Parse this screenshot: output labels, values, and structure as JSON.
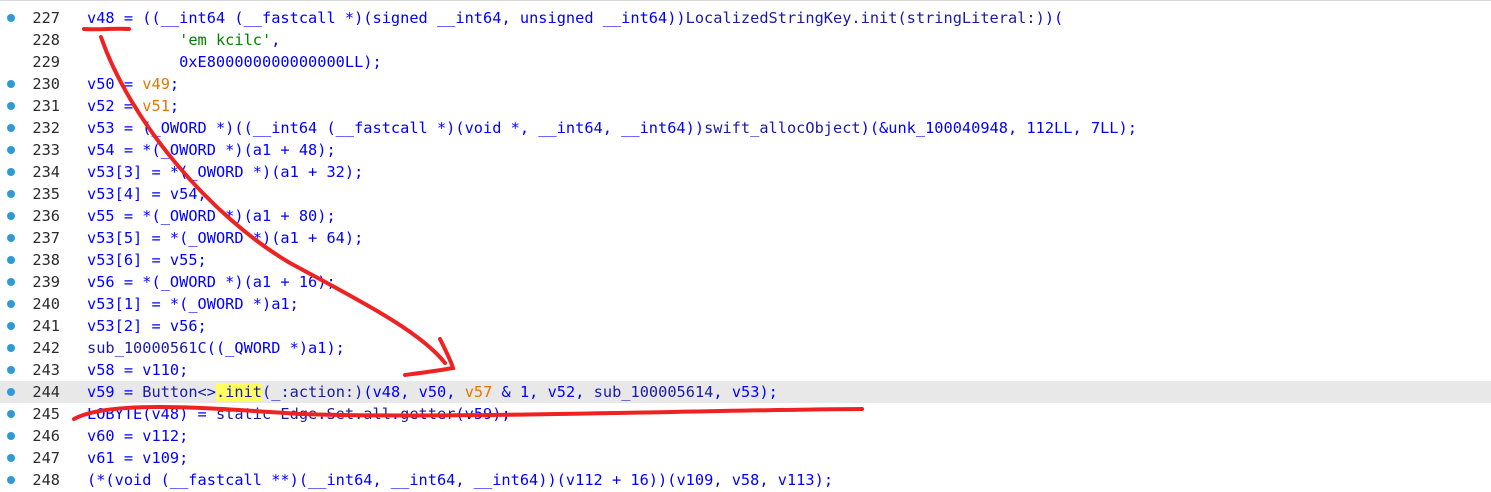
{
  "editor": {
    "current_line": 244,
    "lines": [
      {
        "num": "227",
        "dot": true,
        "tokens": [
          [
            "v",
            "v48"
          ],
          [
            "n",
            " = ((__int64 (__fastcall *)(signed __int64, unsigned __int64))"
          ],
          [
            "f",
            "LocalizedStringKey.init(stringLiteral:)"
          ],
          [
            "n",
            ")("
          ]
        ]
      },
      {
        "num": "228",
        "dot": false,
        "tokens": [
          [
            "n",
            "          "
          ],
          [
            "s",
            "'em kcilc'"
          ],
          [
            "n",
            ","
          ]
        ]
      },
      {
        "num": "229",
        "dot": false,
        "tokens": [
          [
            "n",
            "          0xE800000000000000LL);"
          ]
        ]
      },
      {
        "num": "230",
        "dot": true,
        "tokens": [
          [
            "v",
            "v50"
          ],
          [
            "n",
            " = "
          ],
          [
            "o",
            "v49"
          ],
          [
            "n",
            ";"
          ]
        ]
      },
      {
        "num": "231",
        "dot": true,
        "tokens": [
          [
            "v",
            "v52"
          ],
          [
            "n",
            " = "
          ],
          [
            "o",
            "v51"
          ],
          [
            "n",
            ";"
          ]
        ]
      },
      {
        "num": "232",
        "dot": true,
        "tokens": [
          [
            "v",
            "v53"
          ],
          [
            "n",
            " = (_OWORD *)((__int64 (__fastcall *)(void *, __int64, __int64))"
          ],
          [
            "f",
            "swift_allocObject"
          ],
          [
            "n",
            ")(&unk_100040948, 112LL, 7LL);"
          ]
        ]
      },
      {
        "num": "233",
        "dot": true,
        "tokens": [
          [
            "v",
            "v54"
          ],
          [
            "n",
            " = *(_OWORD *)("
          ],
          [
            "v",
            "a1"
          ],
          [
            "n",
            " + 48);"
          ]
        ]
      },
      {
        "num": "234",
        "dot": true,
        "tokens": [
          [
            "v",
            "v53"
          ],
          [
            "n",
            "[3] = *(_OWORD *)("
          ],
          [
            "v",
            "a1"
          ],
          [
            "n",
            " + 32);"
          ]
        ]
      },
      {
        "num": "235",
        "dot": true,
        "tokens": [
          [
            "v",
            "v53"
          ],
          [
            "n",
            "[4] = "
          ],
          [
            "v",
            "v54"
          ],
          [
            "n",
            ";"
          ]
        ]
      },
      {
        "num": "236",
        "dot": true,
        "tokens": [
          [
            "v",
            "v55"
          ],
          [
            "n",
            " = *(_OWORD *)("
          ],
          [
            "v",
            "a1"
          ],
          [
            "n",
            " + 80);"
          ]
        ]
      },
      {
        "num": "237",
        "dot": true,
        "tokens": [
          [
            "v",
            "v53"
          ],
          [
            "n",
            "[5] = *(_OWORD *)("
          ],
          [
            "v",
            "a1"
          ],
          [
            "n",
            " + 64);"
          ]
        ]
      },
      {
        "num": "238",
        "dot": true,
        "tokens": [
          [
            "v",
            "v53"
          ],
          [
            "n",
            "[6] = "
          ],
          [
            "v",
            "v55"
          ],
          [
            "n",
            ";"
          ]
        ]
      },
      {
        "num": "239",
        "dot": true,
        "tokens": [
          [
            "v",
            "v56"
          ],
          [
            "n",
            " = *(_OWORD *)("
          ],
          [
            "v",
            "a1"
          ],
          [
            "n",
            " + 16);"
          ]
        ]
      },
      {
        "num": "240",
        "dot": true,
        "tokens": [
          [
            "v",
            "v53"
          ],
          [
            "n",
            "[1] = *(_OWORD *)"
          ],
          [
            "v",
            "a1"
          ],
          [
            "n",
            ";"
          ]
        ]
      },
      {
        "num": "241",
        "dot": true,
        "tokens": [
          [
            "v",
            "v53"
          ],
          [
            "n",
            "[2] = "
          ],
          [
            "v",
            "v56"
          ],
          [
            "n",
            ";"
          ]
        ]
      },
      {
        "num": "242",
        "dot": true,
        "tokens": [
          [
            "f",
            "sub_10000561C"
          ],
          [
            "n",
            "((_QWORD *)"
          ],
          [
            "v",
            "a1"
          ],
          [
            "n",
            ");"
          ]
        ]
      },
      {
        "num": "243",
        "dot": true,
        "tokens": [
          [
            "v",
            "v58"
          ],
          [
            "n",
            " = "
          ],
          [
            "v",
            "v110"
          ],
          [
            "n",
            ";"
          ]
        ]
      },
      {
        "num": "244",
        "dot": true,
        "tokens": [
          [
            "v",
            "v59"
          ],
          [
            "n",
            " = "
          ],
          [
            "f",
            "Button<>"
          ],
          [
            "h",
            ".init"
          ],
          [
            "f",
            "(_:action:)"
          ],
          [
            "n",
            "("
          ],
          [
            "v",
            "v48"
          ],
          [
            "n",
            ", "
          ],
          [
            "v",
            "v50"
          ],
          [
            "n",
            ", "
          ],
          [
            "o",
            "v57"
          ],
          [
            "n",
            " & 1, "
          ],
          [
            "v",
            "v52"
          ],
          [
            "n",
            ", "
          ],
          [
            "f",
            "sub_100005614"
          ],
          [
            "n",
            ", "
          ],
          [
            "v",
            "v53"
          ],
          [
            "n",
            ");"
          ]
        ]
      },
      {
        "num": "245",
        "dot": true,
        "tokens": [
          [
            "n",
            "LOBYTE("
          ],
          [
            "v",
            "v48"
          ],
          [
            "n",
            ") = "
          ],
          [
            "f",
            "static Edge.Set.all.getter"
          ],
          [
            "n",
            "("
          ],
          [
            "v",
            "v59"
          ],
          [
            "n",
            ");"
          ]
        ]
      },
      {
        "num": "246",
        "dot": true,
        "tokens": [
          [
            "v",
            "v60"
          ],
          [
            "n",
            " = "
          ],
          [
            "v",
            "v112"
          ],
          [
            "n",
            ";"
          ]
        ]
      },
      {
        "num": "247",
        "dot": true,
        "tokens": [
          [
            "v",
            "v61"
          ],
          [
            "n",
            " = "
          ],
          [
            "v",
            "v109"
          ],
          [
            "n",
            ";"
          ]
        ]
      },
      {
        "num": "248",
        "dot": true,
        "tokens": [
          [
            "n",
            "(*(void (__fastcall **)(__int64, __int64, __int64))("
          ],
          [
            "v",
            "v112"
          ],
          [
            "n",
            " + 16))("
          ],
          [
            "v",
            "v109"
          ],
          [
            "n",
            ", "
          ],
          [
            "v",
            "v58"
          ],
          [
            "n",
            ", "
          ],
          [
            "v",
            "v113"
          ],
          [
            "n",
            ");"
          ]
        ]
      }
    ]
  },
  "annotation": {
    "color": "#ee2222"
  }
}
